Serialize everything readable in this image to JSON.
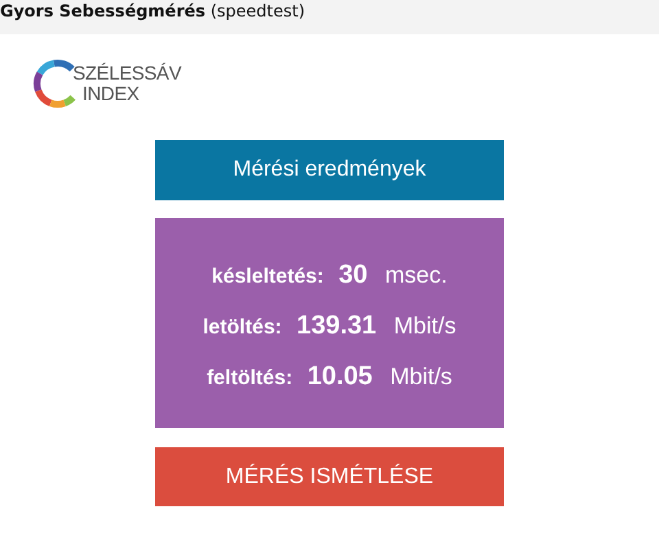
{
  "header": {
    "title": "**Gyors Sebességmérés** (speedtest)"
  },
  "logo": {
    "line_1": "SZÉLESSÁV",
    "line_2": "INDEX"
  },
  "results_title": "Mérési eredmények",
  "metrics": [
    {
      "label": "késleltetés:",
      "value": "30",
      "unit": "msec."
    },
    {
      "label": "letöltés:",
      "value": "139.31",
      "unit": "Mbit/s"
    },
    {
      "label": "feltöltés:",
      "value": "10.05",
      "unit": "Mbit/s"
    }
  ],
  "repeat_button": "MÉRÉS ISMÉTLÉSE"
}
